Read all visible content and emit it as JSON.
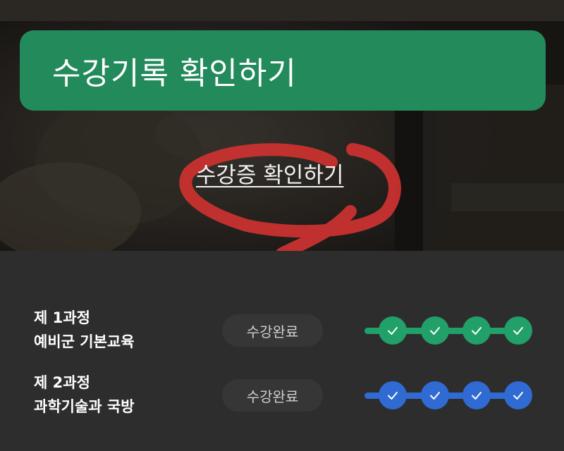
{
  "hero": {
    "title": "수강기록 확인하기",
    "certificate_link": "수강증 확인하기"
  },
  "courses": [
    {
      "number_label": "제 1과정",
      "name": "예비군 기본교육",
      "status": "수강완료",
      "steps_completed": 4,
      "steps_total": 4,
      "color": "#21a06a"
    },
    {
      "number_label": "제 2과정",
      "name": "과학기술과 국방",
      "status": "수강완료",
      "steps_completed": 4,
      "steps_total": 4,
      "color": "#2f6bd3"
    }
  ],
  "colors": {
    "banner": "#238a5c",
    "annotation": "#c8312f",
    "panel_background": "#2d2d2d"
  }
}
